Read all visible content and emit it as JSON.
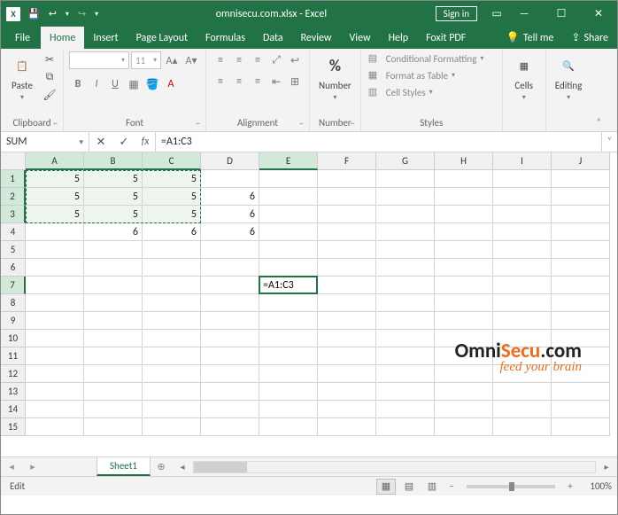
{
  "titlebar": {
    "filename": "omnisecu.com.xlsx",
    "app": "Excel",
    "signin": "Sign in"
  },
  "tabs": {
    "file": "File",
    "home": "Home",
    "insert": "Insert",
    "page_layout": "Page Layout",
    "formulas": "Formulas",
    "data": "Data",
    "review": "Review",
    "view": "View",
    "help": "Help",
    "foxit": "Foxit PDF",
    "tellme": "Tell me",
    "share": "Share"
  },
  "ribbon": {
    "clipboard": {
      "paste": "Paste",
      "label": "Clipboard"
    },
    "font": {
      "name": "",
      "size": "11",
      "label": "Font"
    },
    "alignment": {
      "label": "Alignment"
    },
    "number": {
      "big": "Number",
      "label": "Number",
      "percent": "%"
    },
    "styles": {
      "cond": "Conditional Formatting",
      "table": "Format as Table",
      "cell": "Cell Styles",
      "label": "Styles"
    },
    "cells": {
      "big": "Cells"
    },
    "editing": {
      "big": "Editing"
    }
  },
  "fxbar": {
    "name": "SUM",
    "formula": "=A1:C3"
  },
  "grid": {
    "cols": [
      "A",
      "B",
      "C",
      "D",
      "E",
      "F",
      "G",
      "H",
      "I",
      "J"
    ],
    "rows": [
      1,
      2,
      3,
      4,
      5,
      6,
      7,
      8,
      9,
      10,
      11,
      12,
      13,
      14,
      15
    ],
    "data": {
      "1": {
        "A": "5",
        "B": "5",
        "C": "5"
      },
      "2": {
        "A": "5",
        "B": "5",
        "C": "5",
        "D": "6"
      },
      "3": {
        "A": "5",
        "B": "5",
        "C": "5",
        "D": "6"
      },
      "4": {
        "B": "6",
        "C": "6",
        "D": "6"
      }
    },
    "active_cell_value": "=A1:C3"
  },
  "sheet": {
    "name": "Sheet1"
  },
  "status": {
    "mode": "Edit",
    "zoom": "100%"
  },
  "watermark": {
    "omni": "Omni",
    "secu": "Secu",
    "com": ".com",
    "tag": "feed your brain"
  }
}
